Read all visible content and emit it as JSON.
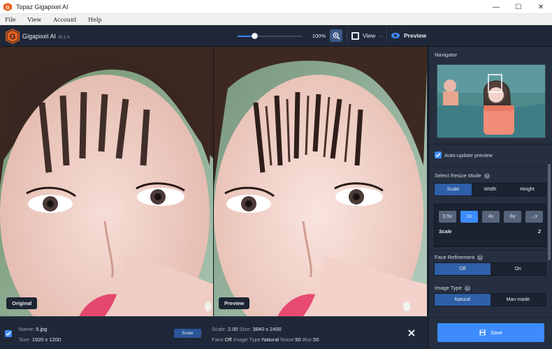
{
  "window": {
    "title": "Topaz Gigapixel AI",
    "controls": {
      "minimize": "—",
      "maximize": "☐",
      "close": "✕"
    }
  },
  "menu": {
    "items": [
      "File",
      "View",
      "Account",
      "Help"
    ]
  },
  "toolbar": {
    "app_name": "Gigapixel AI",
    "version": "v5.1.4",
    "zoom_value": "100%",
    "zoom_level": 0.26,
    "view_label": "View",
    "preview_label": "Preview"
  },
  "panes": {
    "original_label": "Original",
    "preview_label": "Preview"
  },
  "file_info": {
    "name_label": "Name:",
    "name_value": "5.jpg",
    "size_label": "Size:",
    "size_value": "1920 x 1200",
    "mode_pill": "Scale",
    "scale_label": "Scale:",
    "scale_value": "2.00",
    "out_size_label": "Size:",
    "out_size_value": "3840 x 2400",
    "face_label": "Face:",
    "face_value": "Off",
    "type_label": "Image Type:",
    "type_value": "Natural",
    "noise_label": "Noise:",
    "noise_value": "50",
    "blur_label": "Blur:",
    "blur_value": "50"
  },
  "panel": {
    "navigator_title": "Navigator",
    "auto_update_label": "Auto-update preview",
    "resize_mode_title": "Select Resize Mode",
    "resize_modes": [
      "Scale",
      "Width",
      "Height"
    ],
    "scale_options": [
      "0.5x",
      "2x",
      "4x",
      "6x",
      "...x"
    ],
    "scale_label": "Scale",
    "scale_value": "2",
    "face_refinement_title": "Face Refinement",
    "face_options": [
      "Off",
      "On"
    ],
    "image_type_title": "Image Type",
    "image_type_options": [
      "Natural",
      "Man-made"
    ],
    "save_label": "Save"
  },
  "colors": {
    "accent": "#3d8bfd",
    "background": "#1b2332",
    "panel": "#262f3f"
  }
}
